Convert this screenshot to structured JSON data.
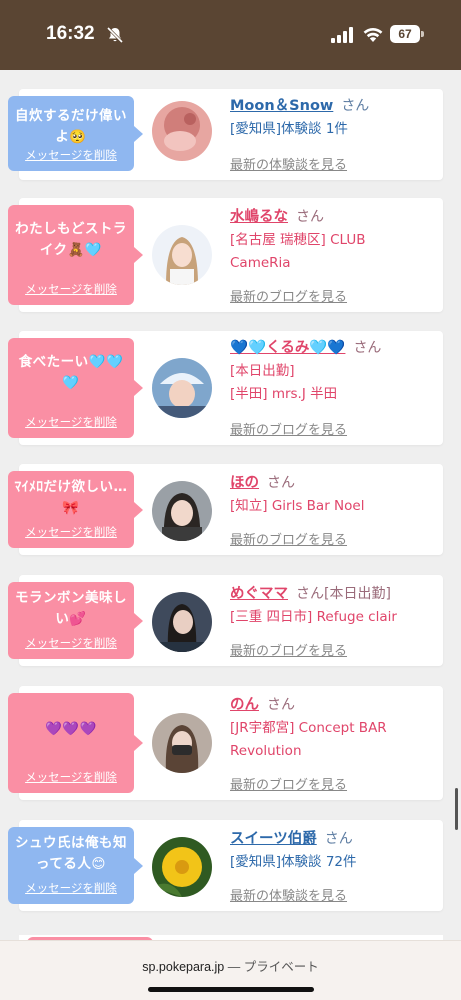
{
  "status_bar": {
    "time": "16:32",
    "battery": "67",
    "icons": [
      "bell-off-icon",
      "signal-icon",
      "wifi-icon",
      "battery-icon"
    ]
  },
  "colors": {
    "header_brown": "#5a4533",
    "pink": "#fa8fa4",
    "blue": "#8fb7f0",
    "name_pink": "#e0456a",
    "name_blue": "#2d69aa"
  },
  "cards": [
    {
      "bubble_color": "blue",
      "message": "自炊するだけ偉いよ🥺",
      "delete_label": "メッセージを削除",
      "name": "Moon＆Snow",
      "san": "さん",
      "details": [
        "[愛知県]体験談 1件"
      ],
      "more_label": "最新の体験談を見る"
    },
    {
      "bubble_color": "pink",
      "message": "わたしもどストライク🧸🩵",
      "delete_label": "メッセージを削除",
      "name": "水嶋るな",
      "san": "さん",
      "details": [
        "[名古屋 瑞穂区] CLUB CameRia"
      ],
      "more_label": "最新のブログを見る"
    },
    {
      "bubble_color": "pink",
      "message": "食べたーい🩵🩵🩵",
      "delete_label": "メッセージを削除",
      "name": "💙🩵くるみ🩵💙",
      "san": "さん",
      "details": [
        "[本日出勤]",
        "[半田] mrs.J 半田"
      ],
      "more_label": "最新のブログを見る"
    },
    {
      "bubble_color": "pink",
      "message": "ﾏｲﾒﾛだけ欲しい…🎀",
      "delete_label": "メッセージを削除",
      "name": "ほの",
      "san": "さん",
      "details": [
        "[知立] Girls Bar Noel"
      ],
      "more_label": "最新のブログを見る"
    },
    {
      "bubble_color": "pink",
      "message": "モランボン美味しい💕",
      "delete_label": "メッセージを削除",
      "name": "めぐママ",
      "san": "さん[本日出勤]",
      "details": [
        "[三重 四日市] Refuge clair"
      ],
      "more_label": "最新のブログを見る"
    },
    {
      "bubble_color": "pink",
      "message": "💜💜💜",
      "delete_label": "メッセージを削除",
      "name": "のん",
      "san": "さん",
      "details": [
        "[JR宇都宮] Concept BAR Revolution"
      ],
      "more_label": "最新のブログを見る"
    },
    {
      "bubble_color": "blue",
      "message": "シュウ氏は俺も知ってる人😊",
      "delete_label": "メッセージを削除",
      "name": "スイーツ伯爵",
      "san": "さん",
      "details": [
        "[愛知県]体験談 72件"
      ],
      "more_label": "最新の体験談を見る"
    }
  ],
  "bottom_bar": {
    "domain": "sp.pokepara.jp",
    "separator": " — ",
    "mode": "プライベート"
  }
}
